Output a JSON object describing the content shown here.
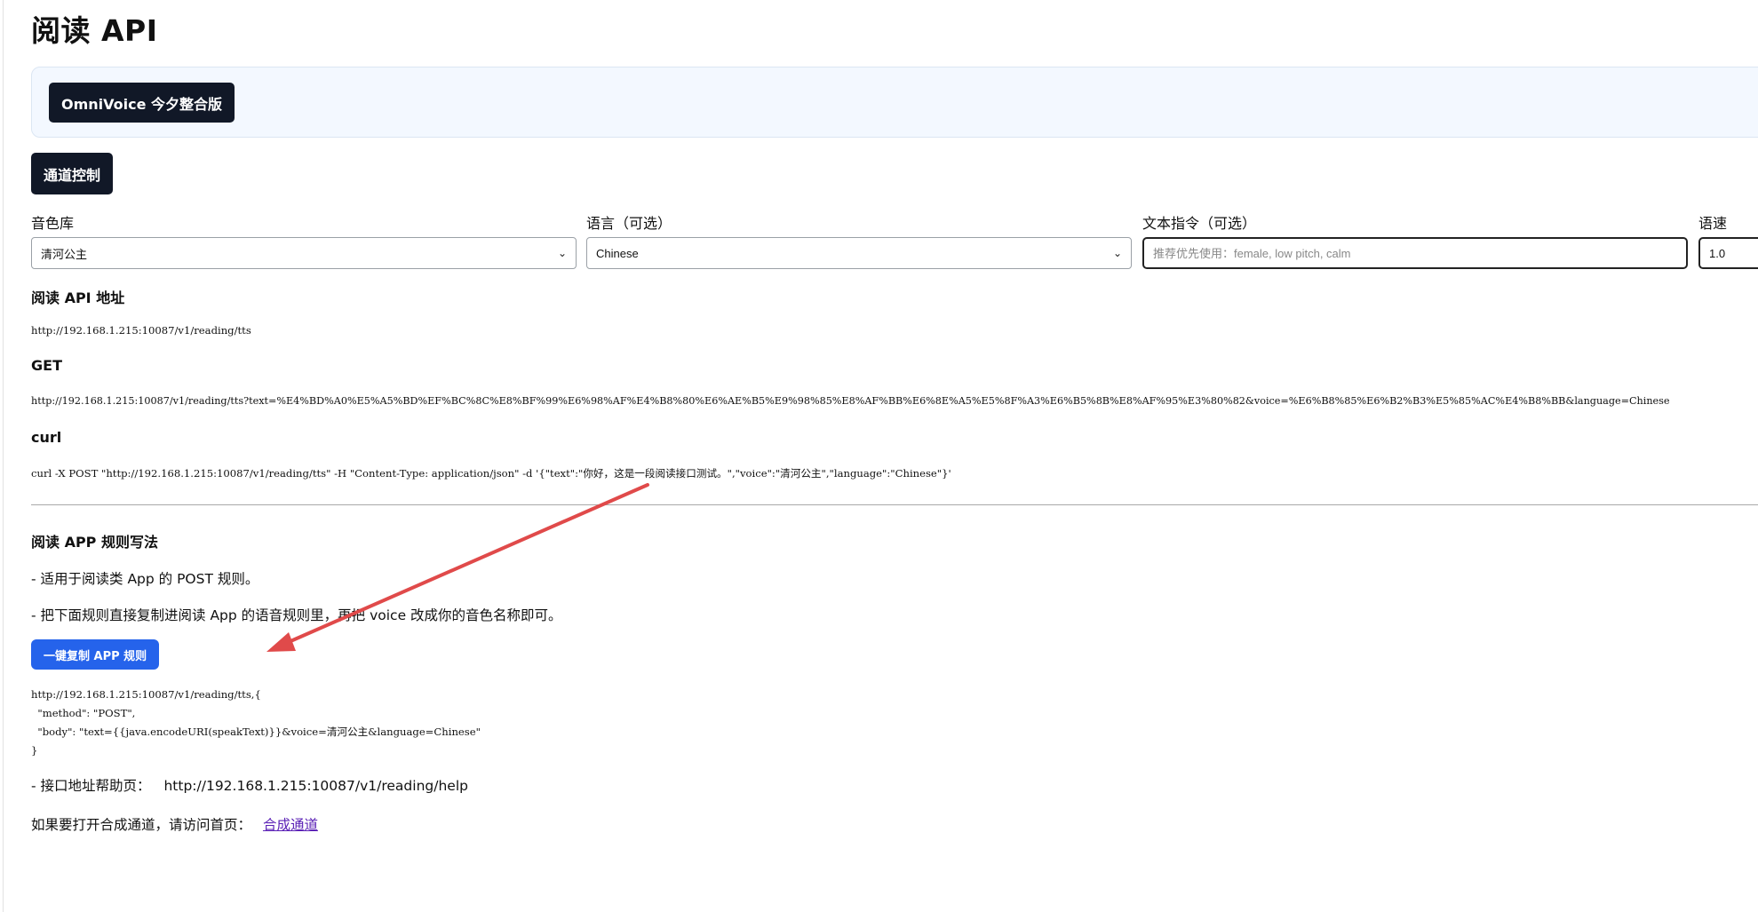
{
  "page": {
    "title": "阅读 API"
  },
  "brand_panel": {
    "button_label": "OmniVoice 今夕整合版"
  },
  "channel_control": {
    "button_label": "通道控制"
  },
  "form": {
    "voice_library": {
      "label": "音色库",
      "value": "清河公主"
    },
    "language": {
      "label": "语言（可选）",
      "value": "Chinese"
    },
    "instruction": {
      "label": "文本指令（可选）",
      "placeholder": "推荐优先使用：female, low pitch, calm",
      "value": ""
    },
    "speed": {
      "label": "语速",
      "value": "1.0"
    }
  },
  "api_address": {
    "heading": "阅读 API 地址",
    "url": "http://192.168.1.215:10087/v1/reading/tts"
  },
  "get_section": {
    "heading": "GET",
    "url": "http://192.168.1.215:10087/v1/reading/tts?text=%E4%BD%A0%E5%A5%BD%EF%BC%8C%E8%BF%99%E6%98%AF%E4%B8%80%E6%AE%B5%E9%98%85%E8%AF%BB%E6%8E%A5%E5%8F%A3%E6%B5%8B%E8%AF%95%E3%80%82&voice=%E6%B8%85%E6%B2%B3%E5%85%AC%E4%B8%BB&language=Chinese"
  },
  "curl_section": {
    "heading": "curl",
    "command": "curl -X POST \"http://192.168.1.215:10087/v1/reading/tts\" -H \"Content-Type: application/json\" -d '{\"text\":\"你好，这是一段阅读接口测试。\",\"voice\":\"清河公主\",\"language\":\"Chinese\"}'"
  },
  "app_rules": {
    "heading": "阅读 APP 规则写法",
    "line1": "- 适用于阅读类 App 的 POST 规则。",
    "line2": "- 把下面规则直接复制进阅读 App 的语音规则里，再把 voice 改成你的音色名称即可。",
    "copy_button": "一键复制 APP 规则",
    "rule_lines": [
      "http://192.168.1.215:10087/v1/reading/tts,{",
      "  \"method\": \"POST\",",
      "  \"body\": \"text={{java.encodeURI(speakText)}}&voice=清河公主&language=Chinese\"",
      "}"
    ],
    "help_label": "- 接口地址帮助页：",
    "help_url": "http://192.168.1.215:10087/v1/reading/help",
    "footer_text": "如果要打开合成通道，请访问首页：",
    "footer_link": "合成通道"
  },
  "icons": {
    "dropdown": "chevron-down-icon",
    "annotation": "red-arrow-annotation"
  },
  "colors": {
    "dark_button": "#111827",
    "blue_button": "#2563eb",
    "panel_bg": "#f3f8ff",
    "link": "#5b21b6",
    "arrow": "#e04a4a"
  }
}
